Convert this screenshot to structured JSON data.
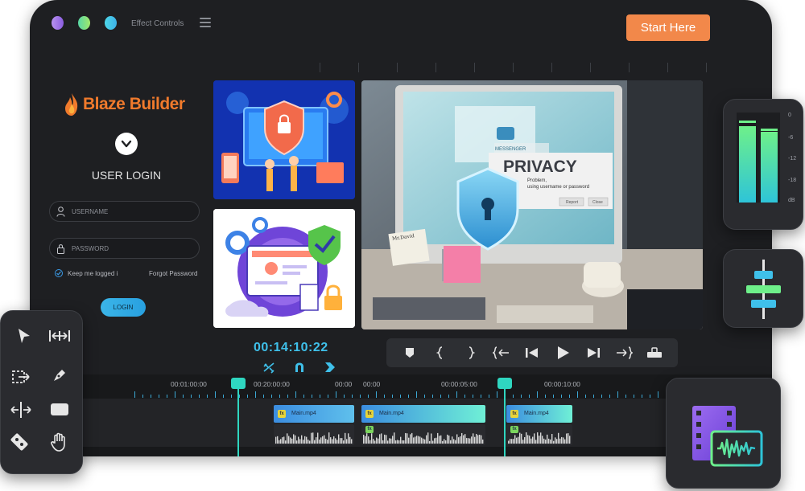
{
  "window": {
    "panel_title": "Effect Controls",
    "start_button": "Start Here"
  },
  "login": {
    "logo_text": "Blaze Builder",
    "heading": "USER LOGIN",
    "username_placeholder": "USERNAME",
    "password_placeholder": "PASSWORD",
    "remember_label": "Keep me logged i",
    "forgot_label": "Forgot Password",
    "login_button": "LOGIN"
  },
  "preview": {
    "messenger_label": "MESSENGER",
    "privacy_title": "PRIVACY",
    "privacy_line1": "Problem,",
    "privacy_line2": "using username or password",
    "report_button": "Report",
    "close_button": "Close",
    "note_text": "Mr.David"
  },
  "player": {
    "timecode": "00:14:10:22"
  },
  "timeline": {
    "labels": [
      "00:01:00:00",
      "00:20:00:00",
      "00:00",
      "00:00",
      "00:00:05:00",
      "00:00:10:00"
    ],
    "clips": [
      "Main.mp4",
      "Main.mp4",
      "Main.mp4"
    ],
    "fx_badge": "fx"
  },
  "meter": {
    "scale": [
      "0",
      "-6",
      "-12",
      "-18",
      "dB"
    ]
  },
  "colors": {
    "accent_orange": "#f2884a",
    "accent_cyan": "#3fc0ea",
    "playhead": "#2fd6c0",
    "window_bg": "#1e1f22"
  },
  "icons": {
    "tools": [
      "pointer-icon",
      "ripple-edit-icon",
      "track-select-icon",
      "pen-icon",
      "slip-icon",
      "rectangle-icon",
      "razor-icon",
      "hand-icon"
    ],
    "transport": [
      "marker-icon",
      "in-point-icon",
      "out-point-icon",
      "go-to-in-icon",
      "step-back-icon",
      "play-icon",
      "step-forward-icon",
      "go-to-out-icon",
      "export-frame-icon"
    ]
  }
}
